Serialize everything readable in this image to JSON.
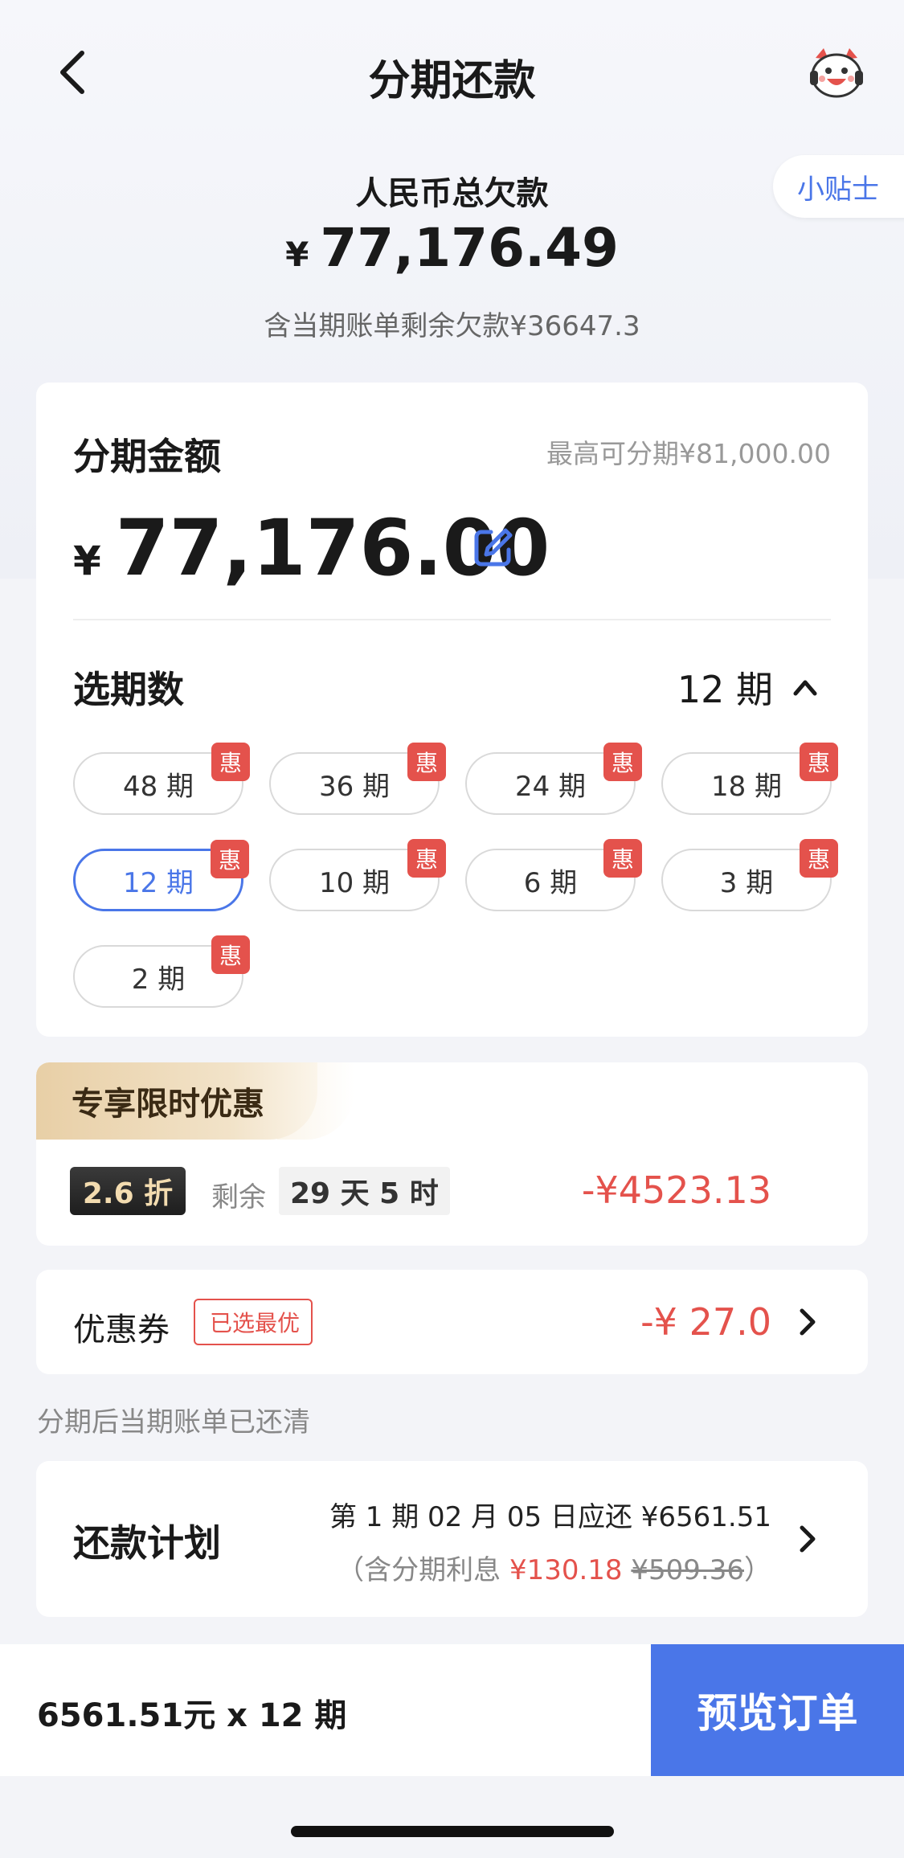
{
  "nav": {
    "title": "分期还款",
    "mascot_icon": "mascot-icon",
    "back_icon": "chevron-left-icon"
  },
  "tips": {
    "label": "小贴士"
  },
  "debt": {
    "label": "人民币总欠款",
    "currency": "¥",
    "amount": "77,176.49",
    "sub": "含当期账单剩余欠款¥36647.3"
  },
  "installment": {
    "title": "分期金额",
    "max": "最高可分期¥81,000.00",
    "currency": "¥",
    "amount": "77,176.00",
    "edit_icon": "edit-icon"
  },
  "periods": {
    "title": "选期数",
    "selected": "12 期",
    "badge": "惠",
    "options": [
      {
        "label": "48 期"
      },
      {
        "label": "36 期"
      },
      {
        "label": "24 期"
      },
      {
        "label": "18 期"
      },
      {
        "label": "12 期"
      },
      {
        "label": "10 期"
      },
      {
        "label": "6 期"
      },
      {
        "label": "3 期"
      },
      {
        "label": "2 期"
      }
    ]
  },
  "promo": {
    "banner": "专享限时优惠",
    "discount": "2.6 折",
    "remain_label": "剩余",
    "remain_time": "29 天 5 时",
    "amount": "-¥4523.13"
  },
  "coupon": {
    "label": "优惠券",
    "tag": "已选最优",
    "amount": "-¥ 27.0"
  },
  "note": "分期后当期账单已还清",
  "plan": {
    "title": "还款计划",
    "line1": "第 1 期 02 月 05 日应还 ¥6561.51",
    "line2_prefix": "（含分期利息 ",
    "interest": "¥130.18",
    "original_interest": "¥509.36",
    "line2_suffix": "）"
  },
  "bottom": {
    "summary": "6561.51元 x 12 期",
    "button": "预览订单"
  },
  "colors": {
    "accent": "#4a76e8",
    "red": "#e4524c"
  }
}
